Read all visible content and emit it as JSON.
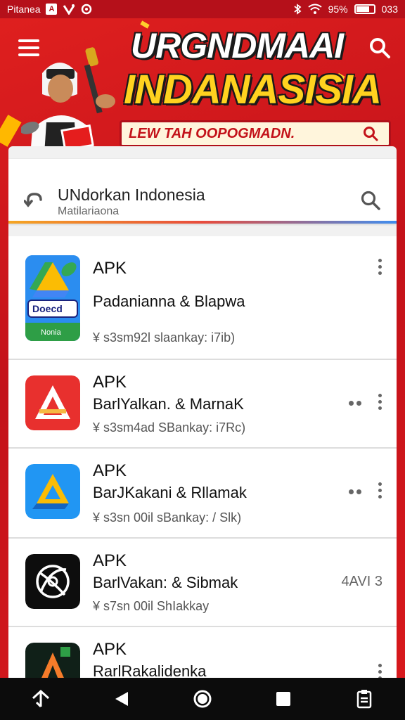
{
  "status_bar": {
    "carrier": "Pitanea",
    "battery_percent": "95%",
    "time": "033",
    "icons": [
      "notification-square-icon",
      "signal-v-icon",
      "alert-circle-icon",
      "bluetooth-icon",
      "wifi-icon",
      "battery-icon"
    ]
  },
  "banner": {
    "title_line1": "URGNDMAAI",
    "title_line2": "INDANASISIA",
    "cta_text": "LEW TAH OOPOGMADN.",
    "colors": {
      "background": "#d8161c",
      "headline_yellow": "#ffd21f",
      "cta_bg": "#fff5dc"
    }
  },
  "search": {
    "query": "UNdorkan Indonesia",
    "subtitle": "Matilariaona"
  },
  "results": [
    {
      "tag": "APK",
      "name": "Padanianna & Blapwa",
      "meta": "¥ s3sm92l slaankay: i7ib)",
      "icon": "drive-triangle-icon",
      "icon_badge": "Doecd",
      "icon_footer": "Nonia"
    },
    {
      "tag": "APK",
      "name": "BarlYalkan. & MarnaK",
      "meta": "¥ s3sm4ad SBankay: i7Rc)",
      "icon": "red-triangle-icon"
    },
    {
      "tag": "APK",
      "name": "BarJKakani & Rllamak",
      "meta": "¥ s3sn 00il sBankay: / Slk)",
      "icon": "blue-drive-icon"
    },
    {
      "tag": "APK",
      "name": "BarlVakan: & Sibmak",
      "meta": "¥ s7sn 00il ShIakkay",
      "icon": "compass-swirl-icon",
      "size": "4AVI 3"
    },
    {
      "tag": "APK",
      "name": "RarlRakalidenka",
      "meta": "",
      "icon": "dark-triangle-icon"
    }
  ],
  "nav": {
    "icons": [
      "home-arrow-icon",
      "back-icon",
      "home-circle-icon",
      "recents-square-icon",
      "clipboard-icon"
    ]
  }
}
